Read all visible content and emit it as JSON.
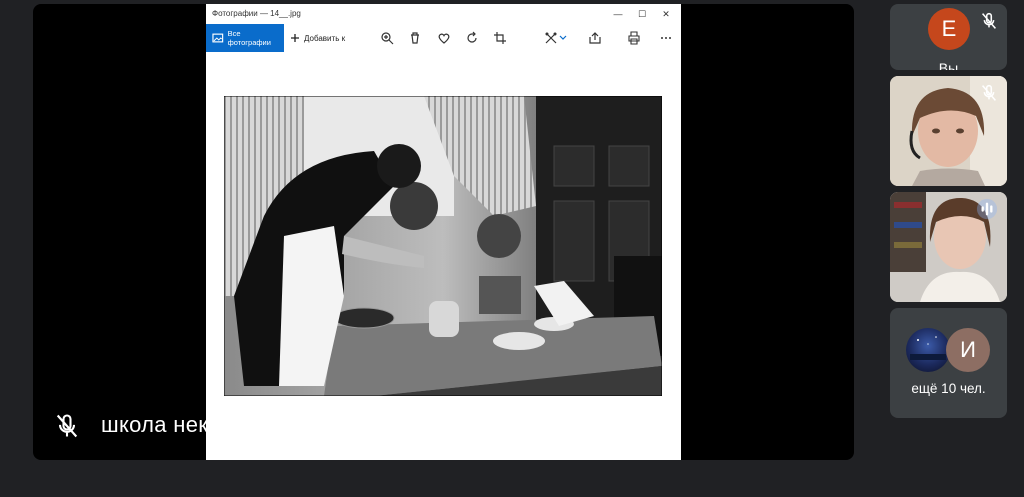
{
  "presenter": {
    "name": "школа некст",
    "mic_state": "muted"
  },
  "photos_app": {
    "window_title": "Фотографии — 14__.jpg",
    "toolbar": {
      "all_photos_label": "Все фотографии",
      "add_label": "Добавить к"
    },
    "window_controls": {
      "minimize": "—",
      "maximize": "☐",
      "close": "✕"
    }
  },
  "participants": {
    "you": {
      "initial": "E",
      "label": "Вы",
      "avatar_color": "#c5471c"
    },
    "more": {
      "initial": "И",
      "label": "ещё 10 чел."
    }
  },
  "colors": {
    "background": "#202124",
    "tile": "#3c4043",
    "accent_blue": "#0a6ccb"
  }
}
